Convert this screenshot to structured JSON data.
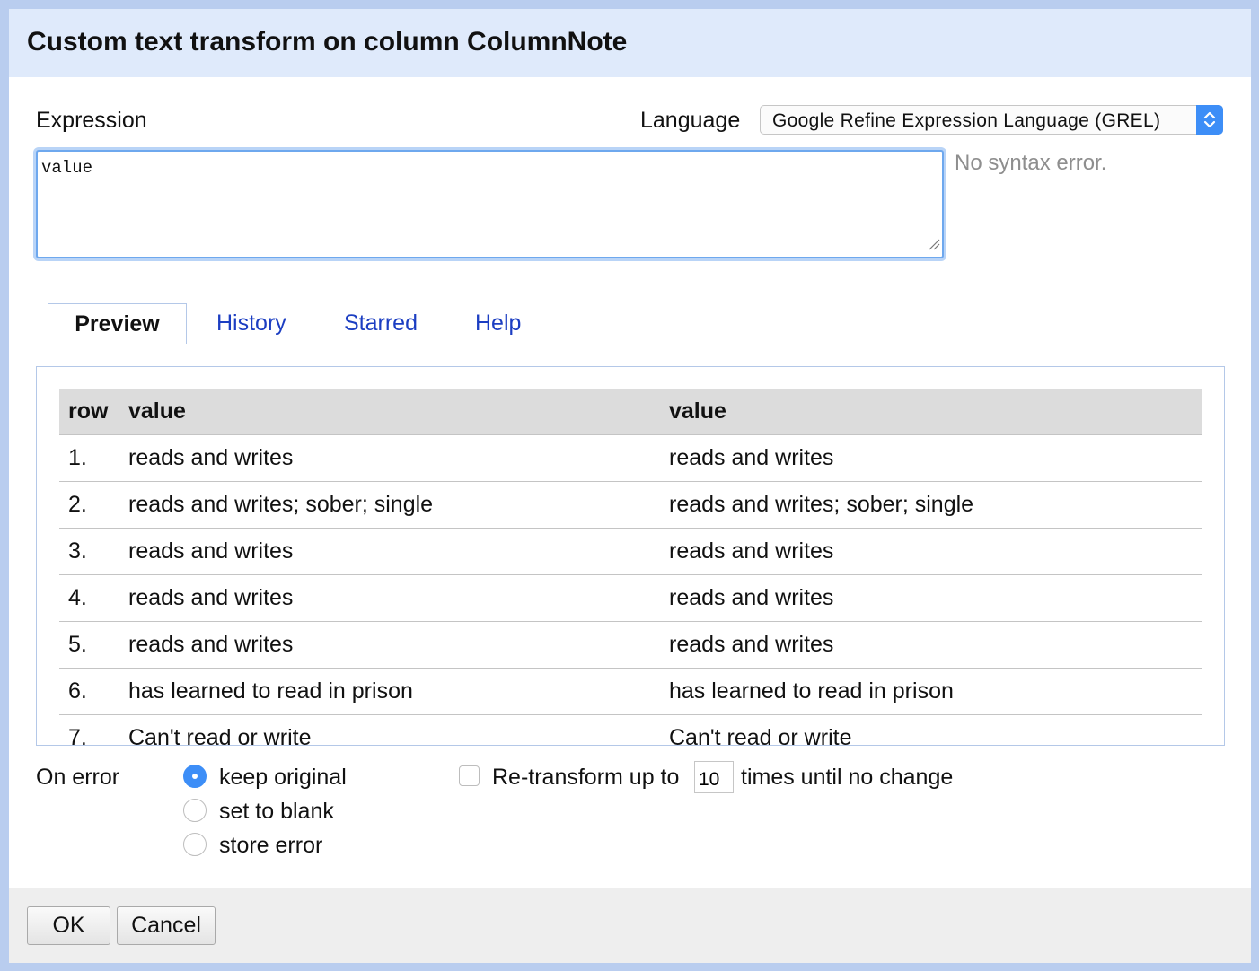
{
  "dialog": {
    "title": "Custom text transform on column ColumnNote"
  },
  "expression": {
    "label": "Expression",
    "value": "value",
    "status": "No syntax error."
  },
  "language": {
    "label": "Language",
    "selected": "Google Refine Expression Language (GREL)"
  },
  "tabs": [
    {
      "label": "Preview",
      "active": true
    },
    {
      "label": "History",
      "active": false
    },
    {
      "label": "Starred",
      "active": false
    },
    {
      "label": "Help",
      "active": false
    }
  ],
  "preview": {
    "headers": [
      "row",
      "value",
      "value"
    ],
    "rows": [
      [
        "1.",
        "reads and writes",
        "reads and writes"
      ],
      [
        "2.",
        "reads and writes; sober; single",
        "reads and writes; sober; single"
      ],
      [
        "3.",
        "reads and writes",
        "reads and writes"
      ],
      [
        "4.",
        "reads and writes",
        "reads and writes"
      ],
      [
        "5.",
        "reads and writes",
        "reads and writes"
      ],
      [
        "6.",
        "has learned to read in prison",
        "has learned to read in prison"
      ],
      [
        "7.",
        "Can't read or write",
        "Can't read or write"
      ]
    ]
  },
  "on_error": {
    "label": "On error",
    "options": [
      {
        "label": "keep original",
        "checked": true
      },
      {
        "label": "set to blank",
        "checked": false
      },
      {
        "label": "store error",
        "checked": false
      }
    ]
  },
  "retransform": {
    "checked": false,
    "label_before": "Re-transform up to",
    "count": "10",
    "label_after": "times until no change"
  },
  "buttons": {
    "ok": "OK",
    "cancel": "Cancel"
  },
  "icons": {
    "select_arrows": "updown-chevron-icon",
    "resize": "resize-grip-icon"
  },
  "colors": {
    "accent": "#3d8ef7",
    "link": "#1c3ec2",
    "titlebar": "#dfeafb"
  }
}
